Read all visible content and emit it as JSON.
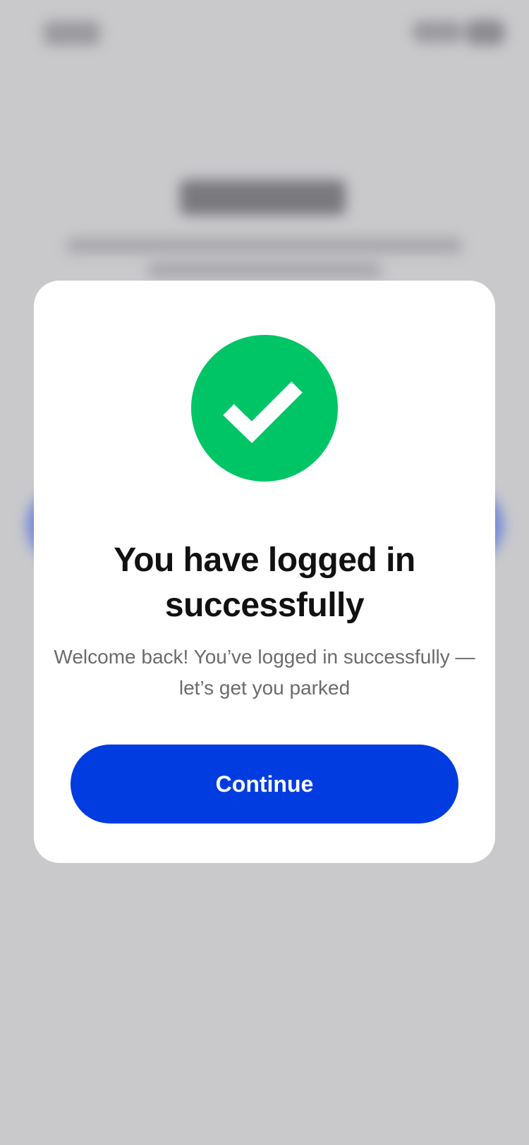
{
  "colors": {
    "overlay_background": "#c9c9cc",
    "modal_background": "#ffffff",
    "success_green": "#00c566",
    "primary_blue": "#003ce0",
    "title_text": "#111111",
    "message_text": "#6b6b6b"
  },
  "modal": {
    "icon": "checkmark-circle-icon",
    "title": "You have logged in successfully",
    "message": "Welcome back! You’ve logged in successfully —let’s get you parked",
    "continue_label": "Continue"
  }
}
